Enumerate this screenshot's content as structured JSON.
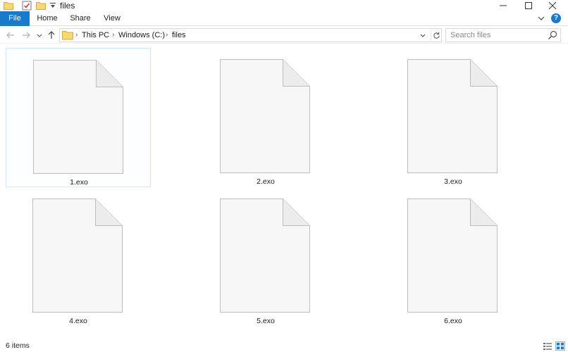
{
  "window": {
    "title": "files"
  },
  "ribbon": {
    "tabs": [
      {
        "label": "File",
        "active": true
      },
      {
        "label": "Home"
      },
      {
        "label": "Share"
      },
      {
        "label": "View"
      }
    ],
    "help_label": "?"
  },
  "address_bar": {
    "crumbs": [
      "This PC",
      "Windows (C:)",
      "files"
    ]
  },
  "search": {
    "placeholder": "Search files"
  },
  "files": [
    {
      "name": "1.exo",
      "selected": true
    },
    {
      "name": "2.exo"
    },
    {
      "name": "3.exo"
    },
    {
      "name": "4.exo"
    },
    {
      "name": "5.exo"
    },
    {
      "name": "6.exo"
    }
  ],
  "status": {
    "item_count": "6 items"
  },
  "colors": {
    "accent": "#1979ca",
    "selection_border": "#cce8ff",
    "folder_yellow": "#f8d775"
  }
}
